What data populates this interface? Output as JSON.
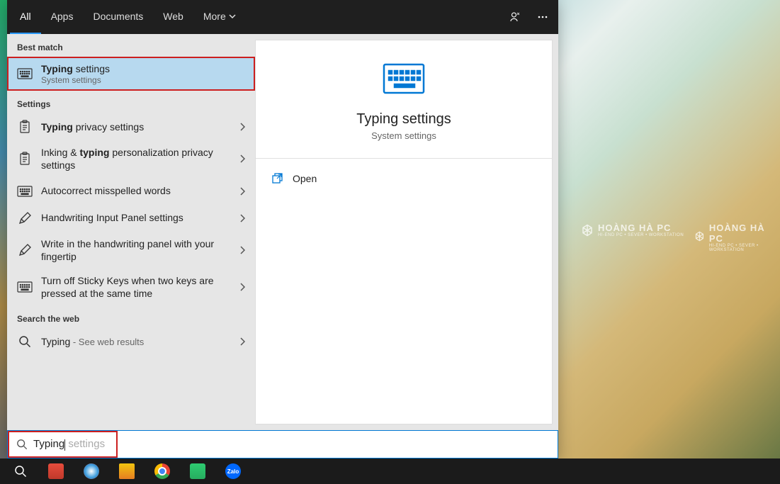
{
  "tabs": {
    "all": "All",
    "apps": "Apps",
    "documents": "Documents",
    "web": "Web",
    "more": "More"
  },
  "sections": {
    "best_match": "Best match",
    "settings": "Settings",
    "search_web": "Search the web"
  },
  "best_match": {
    "title_bold": "Typing",
    "title_rest": " settings",
    "sub": "System settings"
  },
  "settings_items": [
    {
      "pre": "",
      "bold": "Typing",
      "post": " privacy settings",
      "icon": "clipboard"
    },
    {
      "pre": "Inking & ",
      "bold": "typing",
      "post": " personalization privacy settings",
      "icon": "clipboard"
    },
    {
      "pre": "Autocorrect misspelled words",
      "bold": "",
      "post": "",
      "icon": "keyboard"
    },
    {
      "pre": "Handwriting Input Panel settings",
      "bold": "",
      "post": "",
      "icon": "pen"
    },
    {
      "pre": "Write in the handwriting panel with your fingertip",
      "bold": "",
      "post": "",
      "icon": "pen"
    },
    {
      "pre": "Turn off Sticky Keys when two keys are pressed at the same time",
      "bold": "",
      "post": "",
      "icon": "keyboard"
    }
  ],
  "web_item": {
    "query": "Typing",
    "hint": " - See web results"
  },
  "preview": {
    "title": "Typing settings",
    "sub": "System settings",
    "open": "Open"
  },
  "search": {
    "typed": "Typing",
    "ghost": " settings"
  },
  "watermark": {
    "brand": "HOÀNG HÀ PC",
    "sub": "HI-END PC • SEVER • WORKSTATION"
  }
}
